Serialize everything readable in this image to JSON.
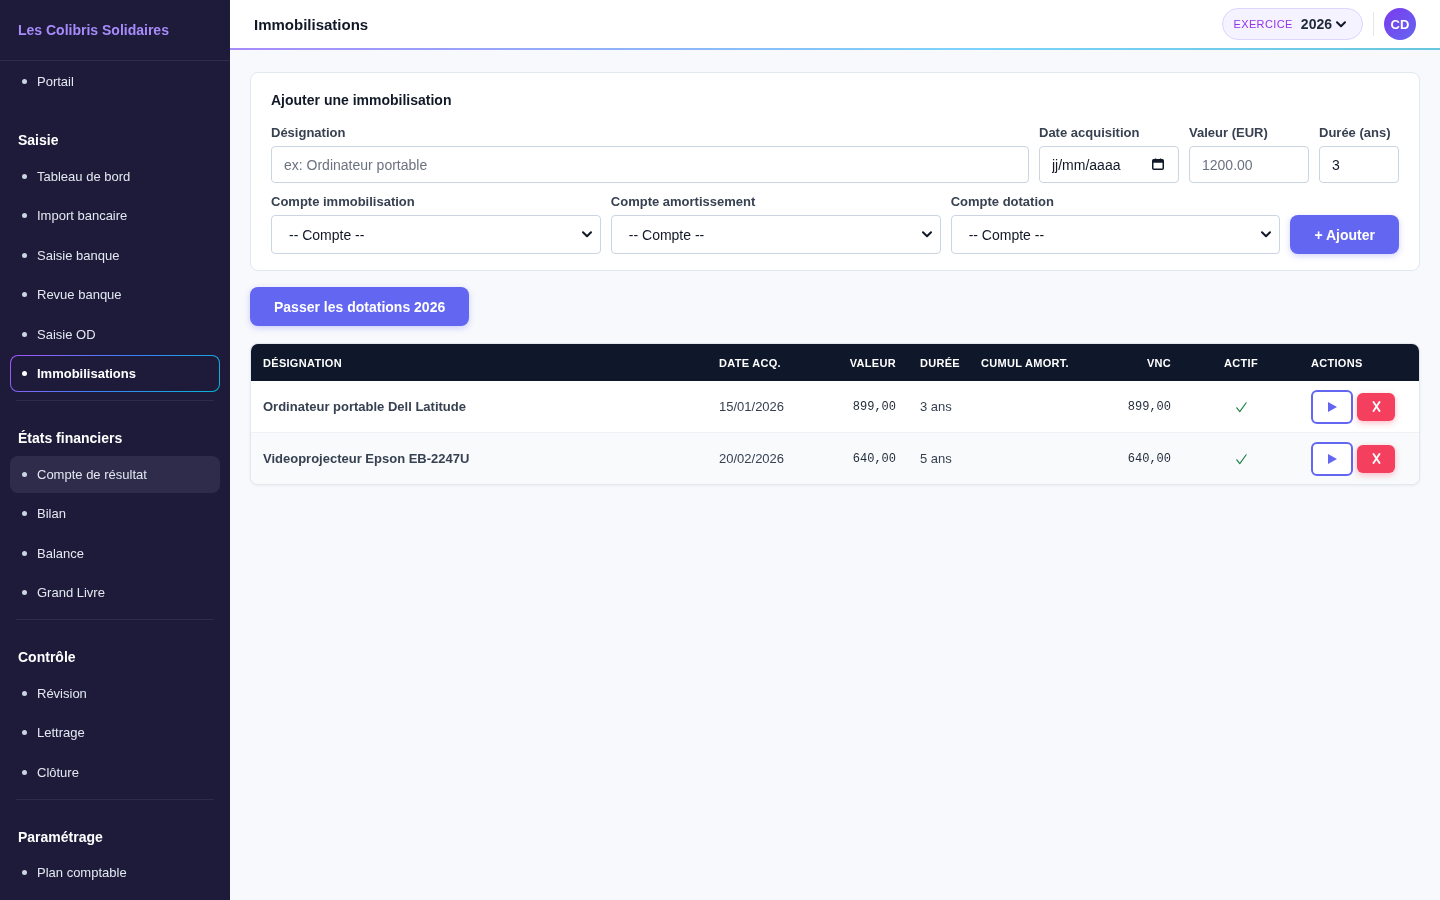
{
  "sidebar": {
    "brand": "Les Colibris Solidaires",
    "groups": [
      {
        "items": [
          {
            "label": "Portail",
            "selected": false,
            "hovered": false
          }
        ]
      },
      {
        "title": "Saisie",
        "items": [
          {
            "label": "Tableau de bord",
            "selected": false,
            "hovered": false
          },
          {
            "label": "Import bancaire",
            "selected": false,
            "hovered": false
          },
          {
            "label": "Saisie banque",
            "selected": false,
            "hovered": false
          },
          {
            "label": "Revue banque",
            "selected": false,
            "hovered": false
          },
          {
            "label": "Saisie OD",
            "selected": false,
            "hovered": false
          },
          {
            "label": "Immobilisations",
            "selected": true,
            "hovered": false
          }
        ]
      },
      {
        "title": "États financiers",
        "items": [
          {
            "label": "Compte de résultat",
            "selected": false,
            "hovered": true
          },
          {
            "label": "Bilan",
            "selected": false,
            "hovered": false
          },
          {
            "label": "Balance",
            "selected": false,
            "hovered": false
          },
          {
            "label": "Grand Livre",
            "selected": false,
            "hovered": false
          }
        ]
      },
      {
        "title": "Contrôle",
        "items": [
          {
            "label": "Révision",
            "selected": false,
            "hovered": false
          },
          {
            "label": "Lettrage",
            "selected": false,
            "hovered": false
          },
          {
            "label": "Clôture",
            "selected": false,
            "hovered": false
          }
        ]
      },
      {
        "title": "Paramétrage",
        "items": [
          {
            "label": "Plan comptable",
            "selected": false,
            "hovered": false
          }
        ]
      }
    ]
  },
  "topbar": {
    "title": "Immobilisations",
    "fiscal_year": {
      "label": "EXERCICE",
      "value": "2026"
    },
    "avatar": "CD"
  },
  "form": {
    "title": "Ajouter une immobilisation",
    "fields": [
      {
        "kind": "text",
        "label": "Désignation",
        "placeholder": "ex: Ordinateur portable"
      },
      {
        "kind": "date",
        "label": "Date acquisition",
        "placeholder": "jj/mm/aaaa"
      },
      {
        "kind": "text",
        "label": "Valeur (EUR)",
        "placeholder": "1200.00"
      },
      {
        "kind": "text",
        "label": "Durée (ans)",
        "value": "3"
      }
    ],
    "selects": [
      {
        "label": "Compte immobilisation",
        "value": "-- Compte --"
      },
      {
        "label": "Compte amortissement",
        "value": "-- Compte --"
      },
      {
        "label": "Compte dotation",
        "value": "-- Compte --"
      }
    ],
    "submit": "+ Ajouter"
  },
  "post_button": "Passer les dotations 2026",
  "table": {
    "columns": [
      "DÉSIGNATION",
      "DATE ACQ.",
      "VALEUR",
      "DURÉE",
      "CUMUL AMORT.",
      "VNC",
      "ACTIF",
      "ACTIONS"
    ],
    "rows": [
      {
        "designation": "Ordinateur portable Dell Latitude",
        "acquired": "15/01/2026",
        "value": "899,00",
        "duration": "3 ans",
        "vnc": "899,00",
        "active": true
      },
      {
        "designation": "Videoprojecteur Epson EB-2247U",
        "acquired": "20/02/2026",
        "value": "640,00",
        "duration": "5 ans",
        "vnc": "640,00",
        "active": true
      }
    ]
  }
}
